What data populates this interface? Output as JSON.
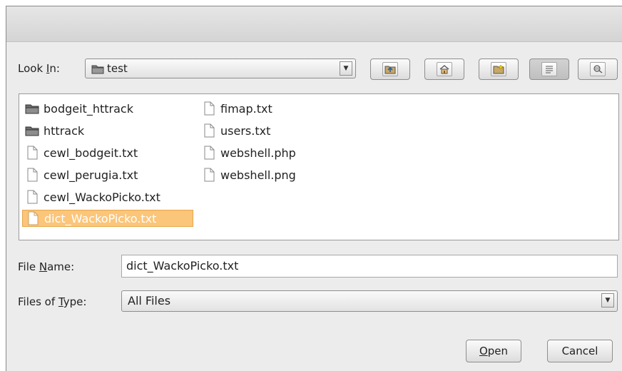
{
  "dialog": {
    "look_in": {
      "label_pre": "Look ",
      "label_mnemonic": "I",
      "label_post": "n:",
      "value": "test"
    },
    "toolbar": {
      "up_folder": "up-folder-icon",
      "home": "home-icon",
      "new_folder": "new-folder-icon",
      "list_view": "list-view-icon",
      "details_view": "details-view-icon"
    },
    "files": [
      {
        "name": "bodgeit_httrack",
        "type": "folder"
      },
      {
        "name": "httrack",
        "type": "folder"
      },
      {
        "name": "cewl_bodgeit.txt",
        "type": "file"
      },
      {
        "name": "cewl_perugia.txt",
        "type": "file"
      },
      {
        "name": "cewl_WackoPicko.txt",
        "type": "file"
      },
      {
        "name": "dict_WackoPicko.txt",
        "type": "file",
        "selected": true
      },
      {
        "name": "fimap.txt",
        "type": "file"
      },
      {
        "name": "users.txt",
        "type": "file"
      },
      {
        "name": "webshell.php",
        "type": "file"
      },
      {
        "name": "webshell.png",
        "type": "file"
      }
    ],
    "file_name": {
      "label_pre": "File ",
      "label_mnemonic": "N",
      "label_post": "ame:",
      "value": "dict_WackoPicko.txt"
    },
    "file_type": {
      "label_pre": "Files of ",
      "label_mnemonic": "T",
      "label_post": "ype:",
      "value": "All Files"
    },
    "buttons": {
      "open_mnemonic": "O",
      "open_rest": "pen",
      "cancel": "Cancel"
    }
  }
}
